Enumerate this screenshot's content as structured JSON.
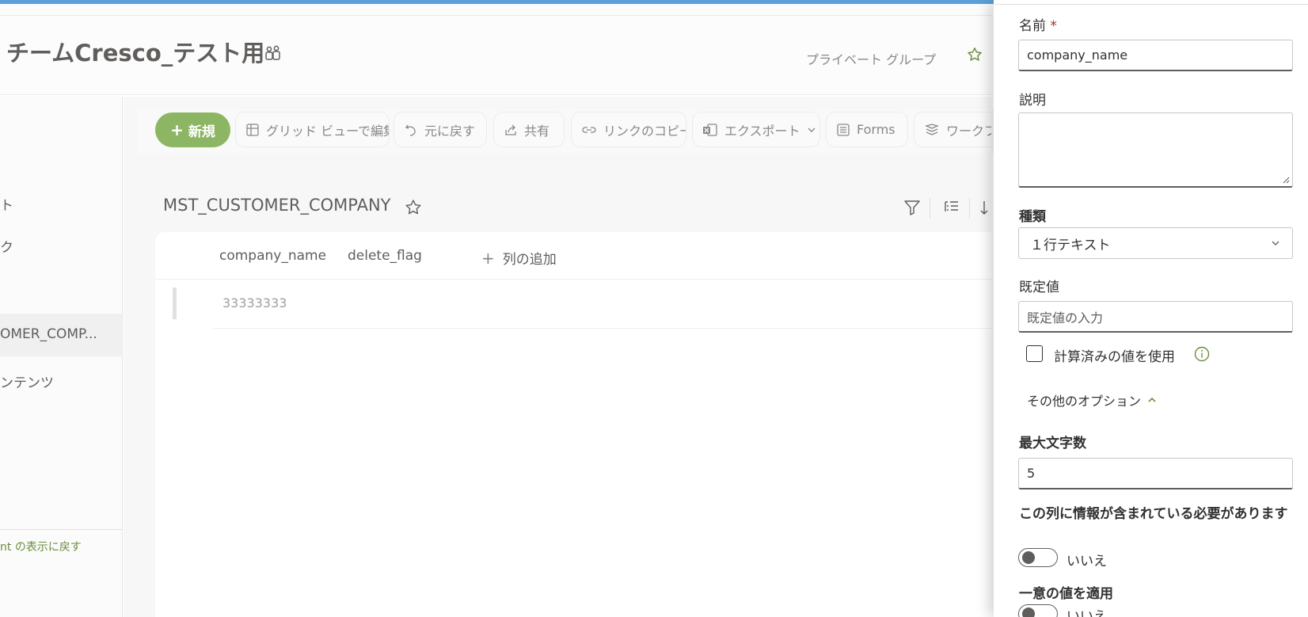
{
  "header": {
    "site_title": "チームCresco_テスト用",
    "privacy_label": "プライベート グループ"
  },
  "leftnav": {
    "items": [
      {
        "label": "ト"
      },
      {
        "label": "ク"
      },
      {
        "label": "OMER_COMP..."
      },
      {
        "label": "ンテンツ"
      }
    ],
    "return_link": "nt の表示に戻す"
  },
  "commandbar": {
    "new_label": "新規",
    "grid_edit_label": "グリッド ビューで編集",
    "undo_label": "元に戻す",
    "share_label": "共有",
    "copy_link_label": "リンクのコピー",
    "export_label": "エクスポート",
    "forms_label": "Forms",
    "workflow_label": "ワークフロ"
  },
  "list": {
    "title": "MST_CUSTOMER_COMPANY",
    "columns": [
      "company_name",
      "delete_flag"
    ],
    "add_column_label": "列の追加",
    "rows": [
      {
        "company_name": "33333333"
      }
    ]
  },
  "panel": {
    "name_label": "名前",
    "required_mark": "*",
    "name_value": "company_name",
    "description_label": "説明",
    "description_value": "",
    "type_label": "種類",
    "type_value": "１行テキスト",
    "default_label": "既定値",
    "default_placeholder": "既定値の入力",
    "calculated_label": "計算済みの値を使用",
    "more_options_label": "その他のオプション",
    "max_chars_label": "最大文字数",
    "max_chars_value": "5",
    "require_info_label": "この列に情報が含まれている必要があります",
    "require_info_value": "いいえ",
    "unique_label": "一意の値を適用",
    "unique_value": "いいえ"
  },
  "colors": {
    "accent_green": "#8cb664",
    "top_bar_blue": "#5ba0d8",
    "link_green": "#6b8e3d"
  }
}
